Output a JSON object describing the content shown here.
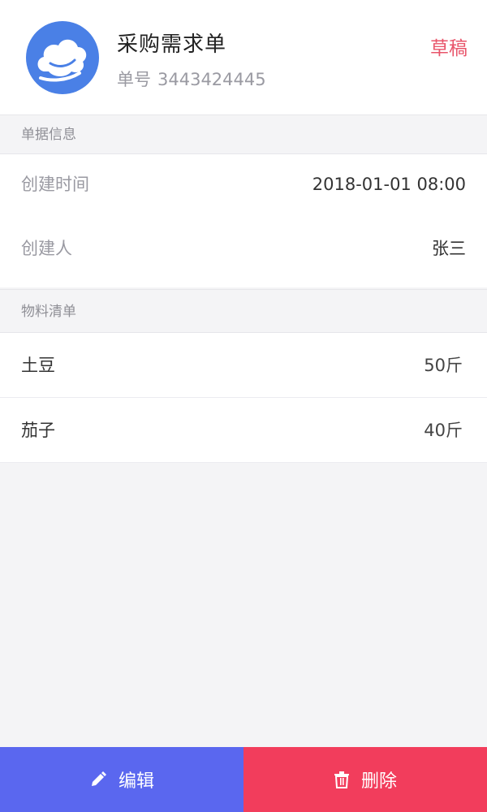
{
  "header": {
    "title": "采购需求单",
    "doc_no_label": "单号",
    "doc_no_value": "3443424445",
    "status": "草稿",
    "avatar_icon": "cloud-logo-icon"
  },
  "sections": {
    "info_title": "单据信息",
    "materials_title": "物料清单"
  },
  "info": [
    {
      "label": "创建时间",
      "value": "2018-01-01 08:00"
    },
    {
      "label": "创建人",
      "value": "张三"
    }
  ],
  "materials": [
    {
      "name": "土豆",
      "qty": "50斤"
    },
    {
      "name": "茄子",
      "qty": "40斤"
    }
  ],
  "actions": {
    "edit_label": "编辑",
    "edit_icon": "pencil-icon",
    "delete_label": "删除",
    "delete_icon": "trash-icon"
  },
  "colors": {
    "accent": "#5a67ef",
    "danger": "#f23d5c",
    "status": "#e8546a",
    "avatar": "#4a80e6"
  }
}
